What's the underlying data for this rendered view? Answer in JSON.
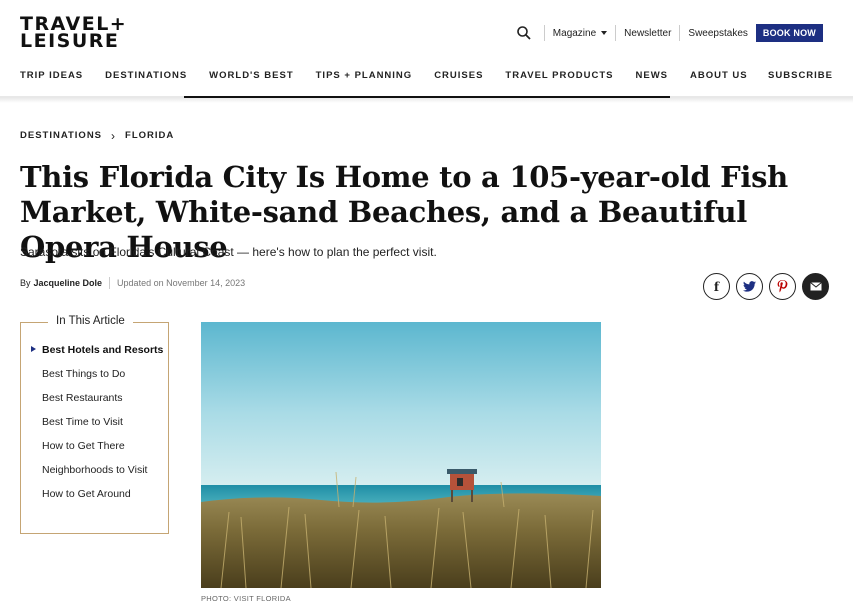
{
  "brand": {
    "logo_line1": "TRAVEL+",
    "logo_line2": "LEISURE"
  },
  "utility": {
    "magazine": "Magazine",
    "newsletter": "Newsletter",
    "sweepstakes": "Sweepstakes",
    "book_now": "BOOK NOW"
  },
  "nav": {
    "items": [
      "TRIP IDEAS",
      "DESTINATIONS",
      "WORLD'S BEST",
      "TIPS + PLANNING",
      "CRUISES",
      "TRAVEL PRODUCTS",
      "NEWS",
      "ABOUT US"
    ],
    "subscribe": "SUBSCRIBE"
  },
  "breadcrumb": {
    "level1": "DESTINATIONS",
    "level2": "FLORIDA"
  },
  "article": {
    "title": "This Florida City Is Home to a 105-year-old Fish Market, White-sand Beaches, and a Beautiful Opera House",
    "dek": "Sarasota sits on Florida's Cultural Coast — here's how to plan the perfect visit.",
    "by_prefix": "By",
    "author": "Jacqueline Dole",
    "updated": "Updated on November 14, 2023"
  },
  "share": {
    "facebook": "f"
  },
  "toc": {
    "title": "In This Article",
    "items": [
      "Best Hotels and Resorts",
      "Best Things to Do",
      "Best Restaurants",
      "Best Time to Visit",
      "How to Get There",
      "Neighborhoods to Visit",
      "How to Get Around"
    ]
  },
  "photo": {
    "credit": "PHOTO: VISIT FLORIDA"
  },
  "colors": {
    "accent": "#1d2f82",
    "toc_border": "#c5a574"
  }
}
